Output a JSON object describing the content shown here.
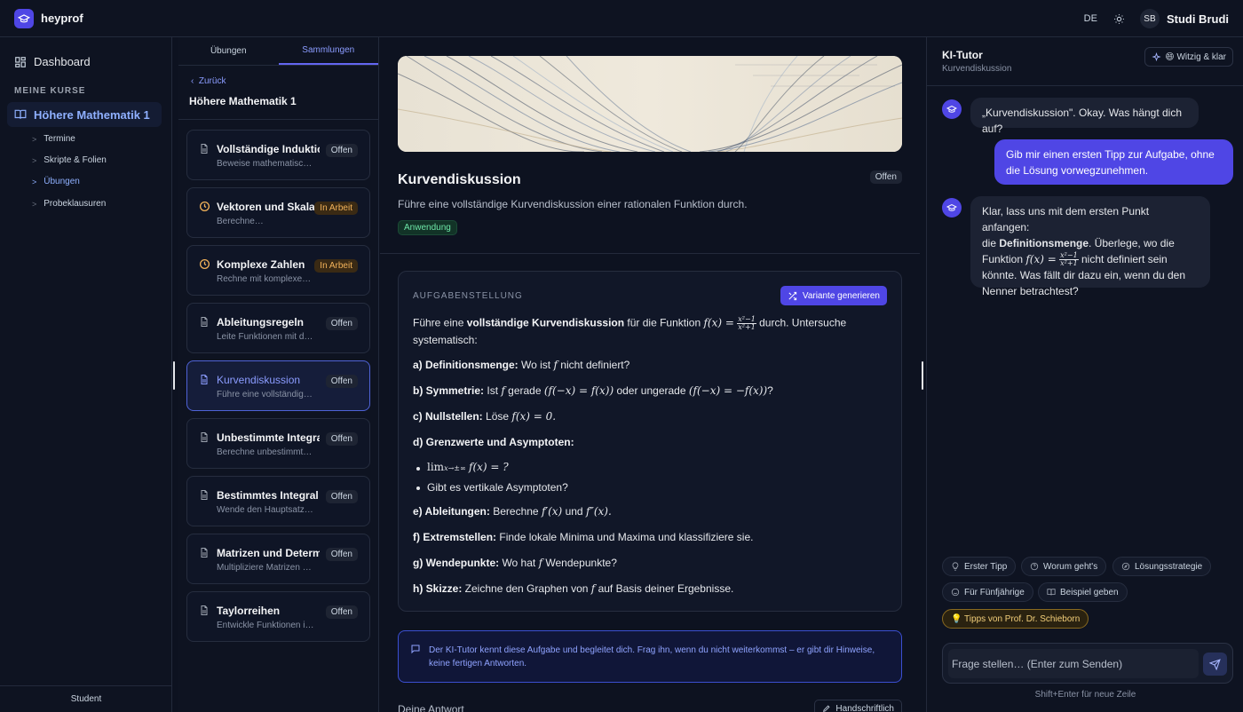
{
  "app": {
    "name": "heyprof"
  },
  "header": {
    "language": "DE",
    "user_initials": "SB",
    "user_name": "Studi Brudi"
  },
  "sidebar": {
    "dashboard": "Dashboard",
    "section_label": "MEINE KURSE",
    "course": "Höhere Mathematik 1",
    "sub_items": [
      "Termine",
      "Skripte & Folien",
      "Übungen",
      "Probeklausuren"
    ],
    "footer": "Student"
  },
  "list": {
    "tabs": [
      "Übungen",
      "Sammlungen"
    ],
    "back": "Zurück",
    "title": "Höhere Mathematik 1",
    "items": [
      {
        "title": "Vollständige Induktion",
        "subtitle": "Beweise mathematische Aussagen",
        "status": "Offen"
      },
      {
        "title": "Vektoren und Skalarprodukt",
        "subtitle": "Berechne…",
        "status": "In Arbeit"
      },
      {
        "title": "Komplexe Zahlen",
        "subtitle": "Rechne mit komplexen Zahlen",
        "status": "In Arbeit"
      },
      {
        "title": "Ableitungsregeln",
        "subtitle": "Leite Funktionen mit den Regeln ab",
        "status": "Offen"
      },
      {
        "title": "Kurvendiskussion",
        "subtitle": "Führe eine vollständige Kurvendiskussion durch",
        "status": "Offen"
      },
      {
        "title": "Unbestimmte Integrale",
        "subtitle": "Berechne unbestimmte Integrale",
        "status": "Offen"
      },
      {
        "title": "Bestimmtes Integral",
        "subtitle": "Wende den Hauptsatz an",
        "status": "Offen"
      },
      {
        "title": "Matrizen und Determinanten",
        "subtitle": "Multipliziere Matrizen und berechne",
        "status": "Offen"
      },
      {
        "title": "Taylorreihen",
        "subtitle": "Entwickle Funktionen in Reihen",
        "status": "Offen"
      }
    ]
  },
  "main": {
    "title": "Kurvendiskussion",
    "status": "Offen",
    "description": "Führe eine vollständige Kurvendiskussion einer rationalen Funktion durch.",
    "tag": "Anwendung",
    "task_label": "AUFGABENSTELLUNG",
    "variant_button": "Variante generieren",
    "intro_a": "Führe eine ",
    "intro_b": "vollständige Kurvendiskussion",
    "intro_c": " für die Funktion ",
    "intro_d": " durch. Untersuche",
    "intro_e": "systematisch:",
    "math": {
      "fx": "f(x) =",
      "frac_num": "x²−1",
      "frac_den": "x²+1",
      "f": "f",
      "f_even": "(f(−x) = f(x))",
      "f_odd": "(f(−x) = −f(x))",
      "f_zero": "f(x) = 0.",
      "limit": "lim",
      "limit_sub": "x→±∞",
      "limit_rest": "f(x) = ?",
      "f1": "f′(x)",
      "f2": "f″(x)."
    },
    "items": {
      "a_label": "a) Definitionsmenge:",
      "a_text1": " Wo ist ",
      "a_text2": " nicht definiert?",
      "b_label": "b) Symmetrie:",
      "b_text1": " Ist ",
      "b_text2": " gerade ",
      "b_text3": " oder ungerade ",
      "b_text4": "?",
      "c_label": "c) Nullstellen:",
      "c_text": " Löse ",
      "d_label": "d) Grenzwerte und Asymptoten:",
      "d_bullet2": "Gibt es vertikale Asymptoten?",
      "e_label": "e) Ableitungen:",
      "e_text1": " Berechne ",
      "e_text2": " und ",
      "f_label": "f) Extremstellen:",
      "f_text": " Finde lokale Minima und Maxima und klassifiziere sie.",
      "g_label": "g) Wendepunkte:",
      "g_text1": " Wo hat ",
      "g_text2": " Wendepunkte?",
      "h_label": "h) Skizze:",
      "h_text1": " Zeichne den Graphen von ",
      "h_text2": " auf Basis deiner Ergebnisse."
    },
    "note_line1": "Der KI-Tutor kennt diese Aufgabe und begleitet dich. Frag ihn, wenn du nicht weiterkommst – er gibt dir Hinweise,",
    "note_line2": "keine fertigen Antworten.",
    "answer_label": "Deine Antwort",
    "handwriting_button": "Handschriftlich"
  },
  "tutor": {
    "title": "KI-Tutor",
    "subtitle": "Kurvendiskussion",
    "mode": "😄 Witzig & klar",
    "msg1": "„Kurvendiskussion\". Okay. Was hängt dich auf?",
    "msg2_line1": "Gib mir einen ersten Tipp zur Aufgabe, ohne",
    "msg2_line2": "die Lösung vorwegzunehmen.",
    "msg3_a": "Klar, lass uns mit dem ersten Punkt anfangen:",
    "msg3_b": "die ",
    "msg3_bold": "Definitionsmenge",
    "msg3_c": ". Überlege, wo die",
    "msg3_d": "Funktion ",
    "msg3_e": " nicht definiert sein",
    "msg3_f": "könnte. Was fällt dir dazu ein, wenn du den",
    "msg3_g": "Nenner betrachtest?",
    "chips": [
      "Erster Tipp",
      "Worum geht's",
      "Lösungsstrategie",
      "Für Fünfjährige",
      "Beispiel geben",
      "💡 Tipps von Prof. Dr. Schieborn"
    ],
    "input_placeholder": "Frage stellen… (Enter zum Senden)",
    "hint": "Shift+Enter für neue Zeile"
  }
}
